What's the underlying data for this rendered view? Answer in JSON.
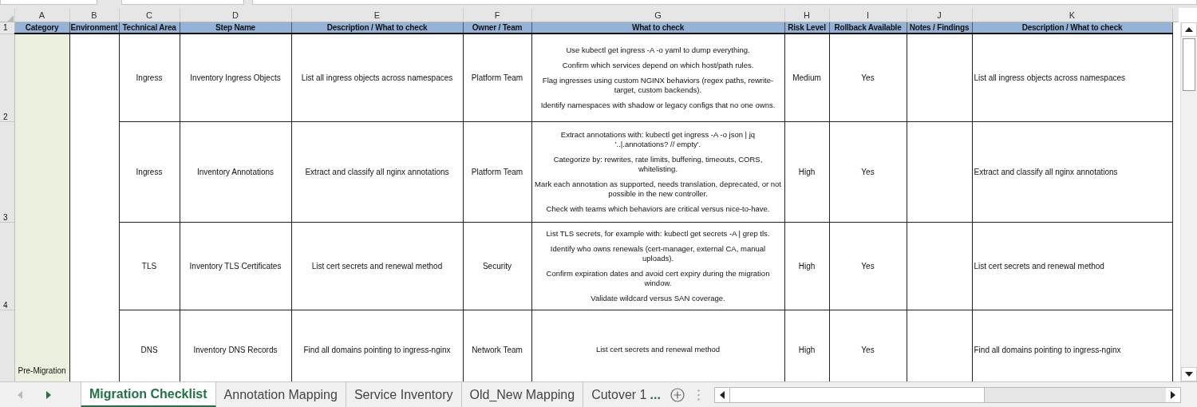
{
  "column_letters": [
    "A",
    "B",
    "C",
    "D",
    "E",
    "F",
    "G",
    "H",
    "I",
    "J",
    "K"
  ],
  "header_row": {
    "row_number": "1",
    "cells": [
      "Category",
      "Environment",
      "Technical Area",
      "Step Name",
      "Description / What to check",
      "Owner / Team",
      "What to check",
      "Risk Level",
      "Rollback Available",
      "Notes / Findings",
      "Description / What to check"
    ]
  },
  "category": "Pre-Migration",
  "rows": [
    {
      "row_number": "2",
      "technical_area": "Ingress",
      "step_name": "Inventory Ingress Objects",
      "description": "List all ingress objects across namespaces",
      "owner": "Platform Team",
      "what_to_check": [
        "Use kubectl get ingress -A -o yaml to dump everything.",
        "Confirm which services depend on which host/path rules.",
        "Flag ingresses using custom NGINX behaviors (regex paths, rewrite-target, custom backends).",
        "Identify namespaces with shadow or legacy configs that no one owns."
      ],
      "risk_level": "Medium",
      "rollback": "Yes",
      "description_k": "List all ingress objects across namespaces"
    },
    {
      "row_number": "3",
      "technical_area": "Ingress",
      "step_name": "Inventory Annotations",
      "description": "Extract and classify all nginx annotations",
      "owner": "Platform Team",
      "what_to_check": [
        "Extract annotations with: kubectl get ingress -A -o json | jq '..|.annotations? // empty'.",
        "Categorize by: rewrites, rate limits, buffering, timeouts, CORS, whitelisting.",
        "Mark each annotation as supported, needs translation, deprecated, or not possible in the new controller.",
        "Check with teams which behaviors are critical versus nice-to-have."
      ],
      "risk_level": "High",
      "rollback": "Yes",
      "description_k": "Extract and classify all nginx annotations"
    },
    {
      "row_number": "4",
      "technical_area": "TLS",
      "step_name": "Inventory TLS Certificates",
      "description": "List cert secrets and renewal method",
      "owner": "Security",
      "what_to_check": [
        "List TLS secrets, for example with: kubectl get secrets -A | grep tls.",
        "Identify who owns renewals (cert-manager, external CA, manual uploads).",
        "Confirm expiration dates and avoid cert expiry during the migration window.",
        "Validate wildcard versus SAN coverage."
      ],
      "risk_level": "High",
      "rollback": "Yes",
      "description_k": "List cert secrets and renewal method"
    },
    {
      "technical_area": "DNS",
      "step_name": "Inventory DNS Records",
      "description": "Find all domains pointing to ingress-nginx",
      "owner": "Network Team",
      "what_to_check": [
        "List cert secrets and renewal method"
      ],
      "risk_level": "High",
      "rollback": "Yes",
      "description_k": "Find all domains pointing to ingress-nginx"
    }
  ],
  "sheet_tabs": [
    {
      "label": "Migration Checklist",
      "selected": true
    },
    {
      "label": "Annotation Mapping",
      "selected": false
    },
    {
      "label": "Service Inventory",
      "selected": false
    },
    {
      "label": "Old_New Mapping",
      "selected": false
    },
    {
      "label": "Cutover 1",
      "selected": false
    }
  ],
  "tab_overflow": "..."
}
